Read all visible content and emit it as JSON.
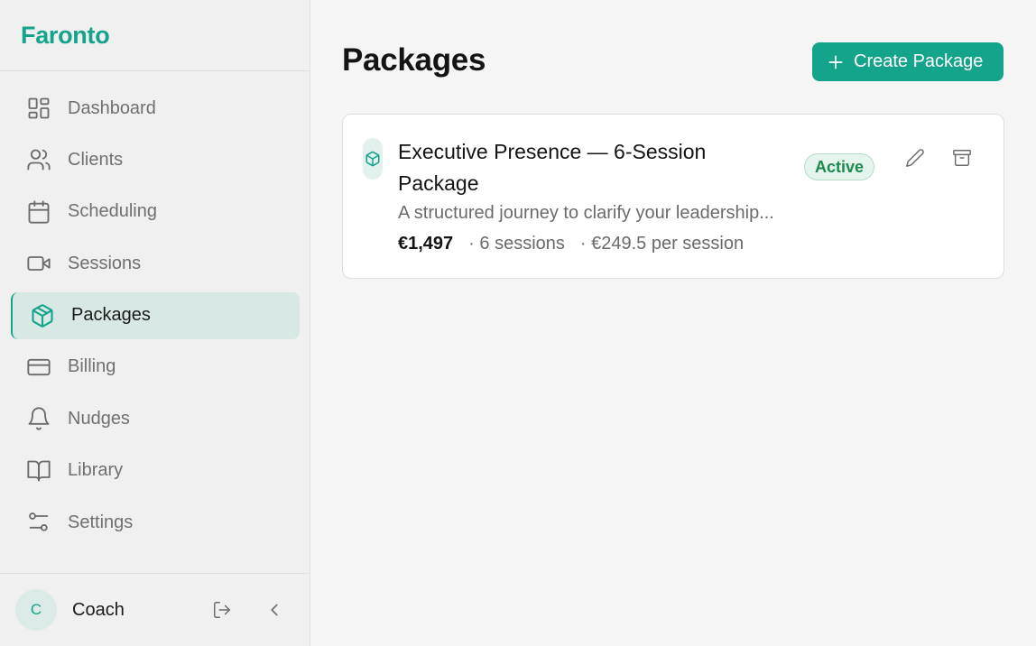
{
  "brand": {
    "name": "Faronto"
  },
  "nav": {
    "items": [
      {
        "label": "Dashboard",
        "icon": "dashboard-icon"
      },
      {
        "label": "Clients",
        "icon": "users-icon"
      },
      {
        "label": "Scheduling",
        "icon": "calendar-icon"
      },
      {
        "label": "Sessions",
        "icon": "video-icon"
      },
      {
        "label": "Packages",
        "icon": "package-icon",
        "active": true
      },
      {
        "label": "Billing",
        "icon": "credit-card-icon"
      },
      {
        "label": "Nudges",
        "icon": "bell-icon"
      },
      {
        "label": "Library",
        "icon": "book-icon"
      },
      {
        "label": "Settings",
        "icon": "sliders-icon"
      }
    ]
  },
  "user": {
    "initial": "C",
    "name": "Coach"
  },
  "page": {
    "title": "Packages",
    "create_label": "Create Package"
  },
  "packages": [
    {
      "title": "Executive Presence — 6-Session Package",
      "description": "A structured journey to clarify your leadership...",
      "price": "€1,497",
      "sessions": "· 6 sessions",
      "per_session": "· €249.5 per session",
      "status": "Active"
    }
  ],
  "colors": {
    "accent": "#14a38b",
    "active_bg": "#d8e8e5",
    "badge_text": "#1b8a4e"
  }
}
